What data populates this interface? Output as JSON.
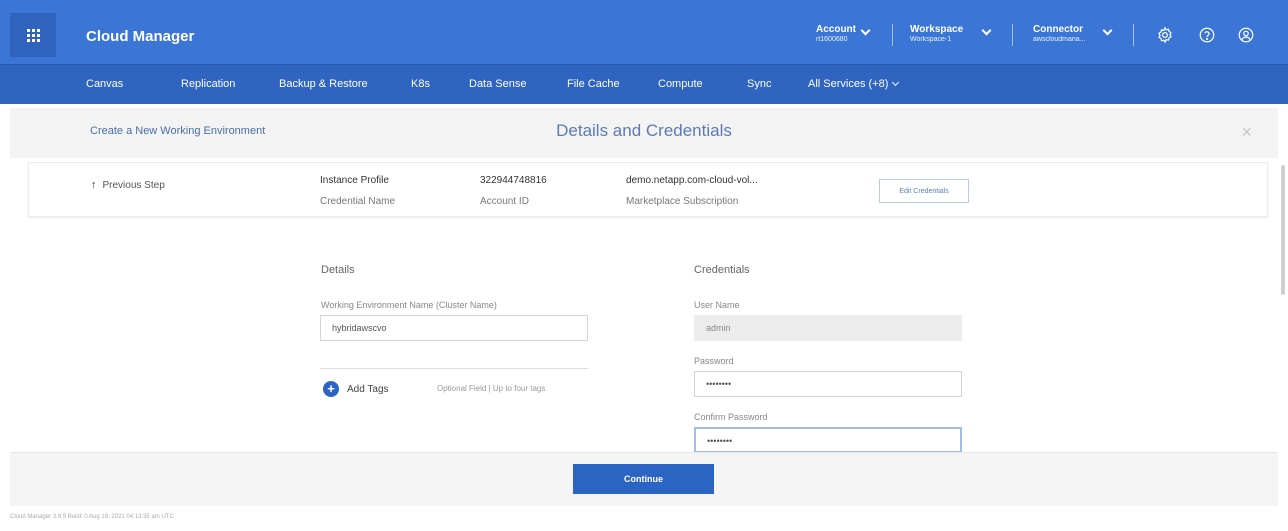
{
  "header": {
    "app_title": "Cloud Manager",
    "account": {
      "label": "Account",
      "value": "rt1600680"
    },
    "workspace": {
      "label": "Workspace",
      "value": "Workspace-1"
    },
    "connector": {
      "label": "Connector",
      "value": "awscloudmana..."
    },
    "icons": [
      "grid-menu-icon",
      "gear-icon",
      "help-icon",
      "user-icon"
    ],
    "color": "#3b76d6"
  },
  "nav": {
    "items": [
      "Canvas",
      "Replication",
      "Backup & Restore",
      "K8s",
      "Data Sense",
      "File Cache",
      "Compute",
      "Sync"
    ],
    "all_services": "All Services (+8)",
    "color": "#2f64c0"
  },
  "subheader": {
    "left_title": "Create a New Working Environment",
    "center_title": "Details and Credentials",
    "close_glyph": "×"
  },
  "info_card": {
    "previous_step": "Previous Step",
    "instance_profile": "Instance Profile",
    "credential_name_label": "Credential Name",
    "account_id_value": "322944748816",
    "account_id_label": "Account ID",
    "subscription_value": "demo.netapp.com-cloud-vol...",
    "subscription_label": "Marketplace Subscription",
    "edit_button": "Edit Credentials"
  },
  "details": {
    "title": "Details",
    "cluster_name_label": "Working Environment Name (Cluster Name)",
    "cluster_name_value": "hybridawscvo",
    "add_tags": "Add Tags",
    "optional_hint": "Optional Field | Up to four tags"
  },
  "credentials": {
    "title": "Credentials",
    "username_label": "User Name",
    "username_value": "admin",
    "password_label": "Password",
    "password_value": "••••••••",
    "confirm_label": "Confirm Password",
    "confirm_value": "••••••••"
  },
  "footer": {
    "continue_button": "Continue",
    "version": "Cloud Manager 3.9.9   Build: 0   Aug 18, 2021 04:13:35 am UTC"
  }
}
